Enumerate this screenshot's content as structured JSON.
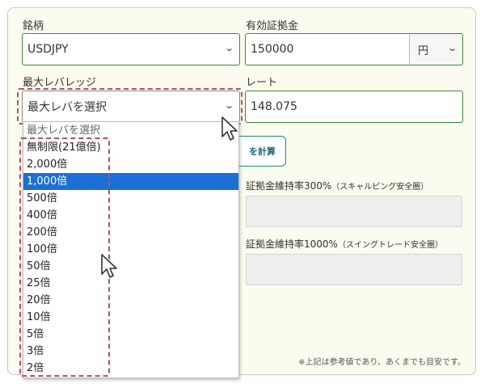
{
  "form": {
    "symbol_label": "銘柄",
    "symbol_value": "USDJPY",
    "margin_label": "有効証拠金",
    "margin_value": "150000",
    "margin_unit": "円",
    "leverage_label": "最大レバレッジ",
    "leverage_value": "最大レバを選択",
    "rate_label": "レート",
    "rate_value": "148.075",
    "calc_button": "を計算",
    "ratio300_label": "証拠金維持率300%",
    "ratio300_sub": "（スキャルピング安全圏）",
    "ratio1000_label": "証拠金維持率1000%",
    "ratio1000_sub": "（スイングトレード安全圏）",
    "note": "※上記は参考値であり、あくまでも目安です。"
  },
  "dropdown": {
    "options": [
      "最大レバを選択",
      "無制限(21億倍)",
      "2,000倍",
      "1,000倍",
      "500倍",
      "400倍",
      "200倍",
      "100倍",
      "50倍",
      "25倍",
      "20倍",
      "10倍",
      "5倍",
      "3倍",
      "2倍"
    ],
    "selected": "1,000倍"
  },
  "colors": {
    "panel_bg": "#fcfbef",
    "field_border": "#3a8a3a",
    "highlight": "#1c6fd4",
    "annotation": "#b05070"
  }
}
